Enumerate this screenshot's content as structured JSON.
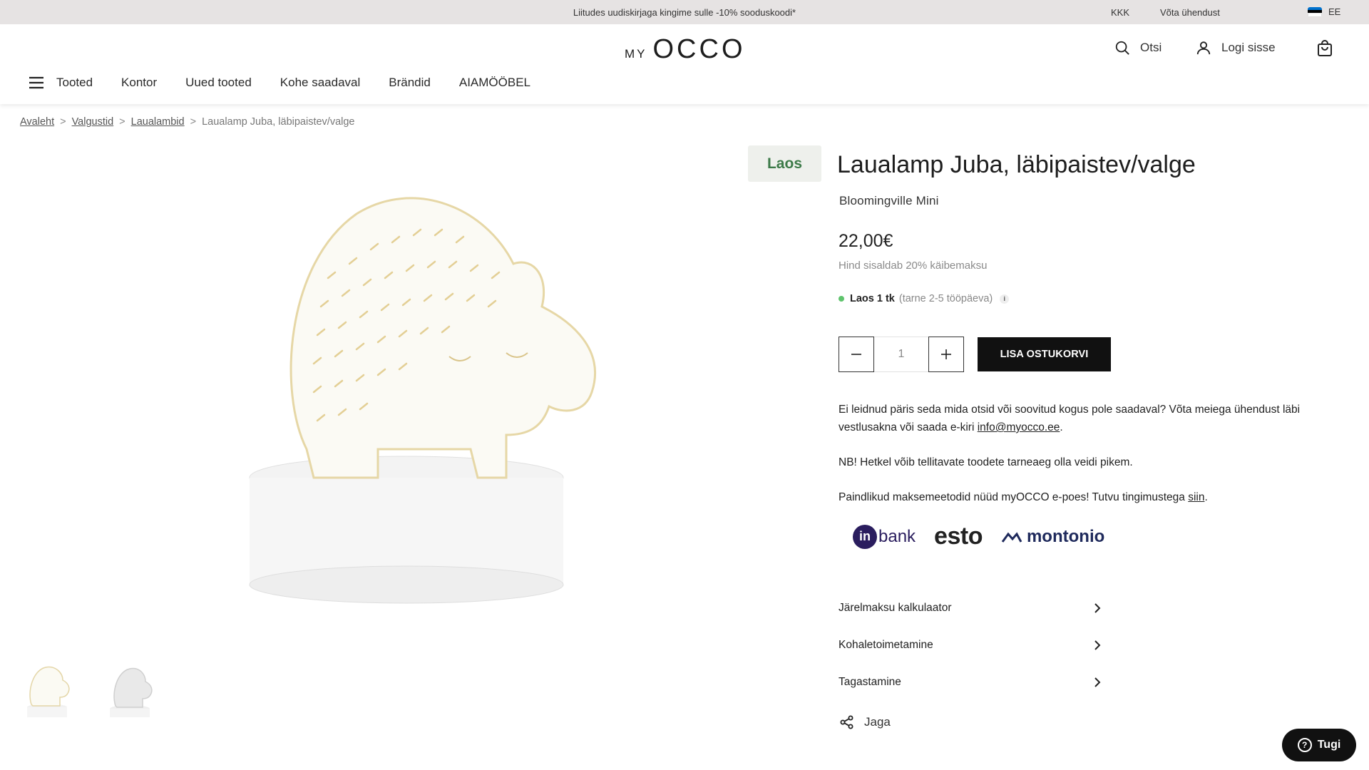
{
  "topbar": {
    "promo": "Liitudes uudiskirjaga kingime sulle -10% sooduskoodi*",
    "faq": "KKK",
    "contact": "Võta ühendust",
    "language": "EE"
  },
  "header": {
    "logo_my": "MY",
    "logo_occo": "OCCO",
    "search_label": "Otsi",
    "login_label": "Logi sisse"
  },
  "nav": {
    "items": [
      "Tooted",
      "Kontor",
      "Uued tooted",
      "Kohe saadaval",
      "Brändid",
      "AIAMÖÖBEL"
    ]
  },
  "breadcrumb": {
    "items": [
      "Avaleht",
      "Valgustid",
      "Laualambid"
    ],
    "separator": ">",
    "current": "Laualamp Juba, läbipaistev/valge"
  },
  "gallery": {
    "badge": "Laos",
    "thumbnails": [
      "lamp-front",
      "lamp-grey"
    ]
  },
  "product": {
    "title": "Laualamp Juba, läbipaistev/valge",
    "brand": "Bloomingville Mini",
    "price": "22,00€",
    "vat_note": "Hind sisaldab 20% käibemaksu",
    "stock_main": "Laos 1 tk",
    "stock_sub": "(tarne 2-5 tööpäeva)",
    "quantity": "1",
    "add_to_cart": "LISA OSTUKORVI"
  },
  "info_text": {
    "p1_text": "Ei leidnud päris seda mida otsid või soovitud kogus pole saadaval? Võta meiega ühendust läbi vestlusakna või saada e-kiri ",
    "p1_link": "info@myocco.ee",
    "p1_end": ".",
    "p2": "NB! Hetkel võib tellitavate toodete tarneaeg olla veidi pikem.",
    "p3_text": "Paindlikud maksemeetodid nüüd myOCCO e-poes! Tutvu tingimustega ",
    "p3_link": "siin",
    "p3_end": "."
  },
  "payments": {
    "inbank_mark": "in",
    "inbank_text": "bank",
    "esto": "esto",
    "montonio": "montonio"
  },
  "accordions": [
    "Järelmaksu kalkulaator",
    "Kohaletoimetamine",
    "Tagastamine"
  ],
  "share_label": "Jaga",
  "support_label": "Tugi",
  "colors": {
    "accent_green": "#3c7a48",
    "stock_dot": "#5fc46d",
    "button_black": "#111111"
  }
}
